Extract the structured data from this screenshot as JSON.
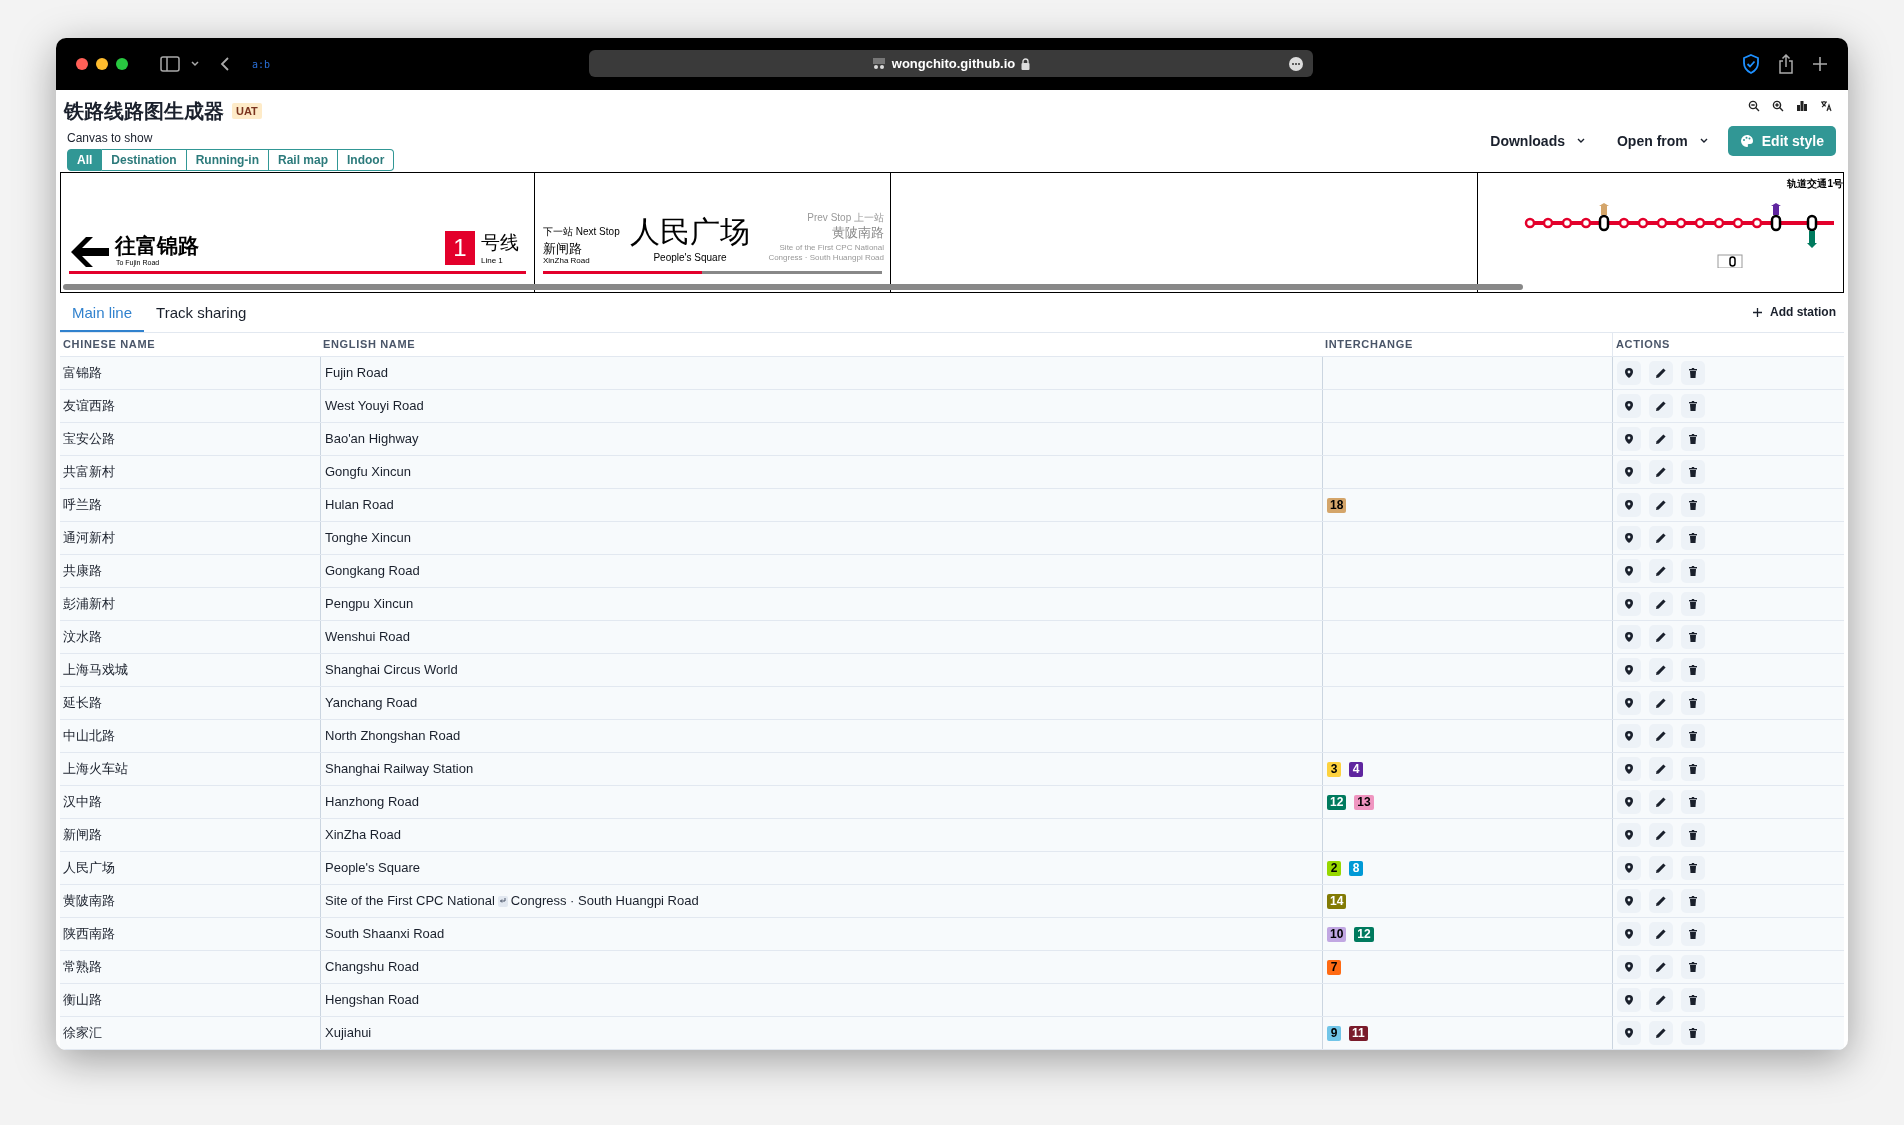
{
  "browser": {
    "extension_label": "a:b",
    "url": "wongchito.github.io"
  },
  "app": {
    "title": "铁路线路图生成器",
    "badge": "UAT",
    "canvas_label": "Canvas to show",
    "canvas_options": [
      {
        "label": "All",
        "selected": true
      },
      {
        "label": "Destination",
        "selected": false
      },
      {
        "label": "Running-in",
        "selected": false
      },
      {
        "label": "Rail map",
        "selected": false
      },
      {
        "label": "Indoor",
        "selected": false
      }
    ],
    "menus": [
      "Downloads",
      "Open from"
    ],
    "edit_button": "Edit style"
  },
  "canvas_preview": {
    "destination": {
      "direction": "往富锦路",
      "direction_en": "To Fujin Road",
      "line_number": "1",
      "line_label": "号线",
      "line_label_en": "Line 1"
    },
    "running_in": {
      "next_label": "下一站",
      "next_label_en": "Next Stop",
      "next_station": "新闸路",
      "next_station_en": "XinZha Road",
      "current": "人民广场",
      "current_en": "People's Square",
      "prev_label_en": "Prev Stop",
      "prev_label": "上一站",
      "prev_station": "黄陂南路",
      "prev_station_en": [
        "Site of the First CPC National",
        "Congress · South Huangpi Road"
      ],
      "level": 0.47
    },
    "rail_map": {
      "title": "轨道交通1号"
    }
  },
  "tabs": [
    {
      "label": "Main line",
      "selected": true
    },
    {
      "label": "Track sharing",
      "selected": false
    }
  ],
  "add_station": "Add station",
  "table": {
    "columns": [
      "CHINESE NAME",
      "ENGLISH NAME",
      "INTERCHANGE",
      "ACTIONS"
    ],
    "rows": [
      {
        "chinese": "富锦路",
        "english": [
          "Fujin Road"
        ],
        "interchange": []
      },
      {
        "chinese": "友谊西路",
        "english": [
          "West Youyi Road"
        ],
        "interchange": []
      },
      {
        "chinese": "宝安公路",
        "english": [
          "Bao'an Highway"
        ],
        "interchange": []
      },
      {
        "chinese": "共富新村",
        "english": [
          "Gongfu Xincun"
        ],
        "interchange": []
      },
      {
        "chinese": "呼兰路",
        "english": [
          "Hulan Road"
        ],
        "interchange": [
          {
            "label": "18",
            "color": "#d4a56a"
          }
        ]
      },
      {
        "chinese": "通河新村",
        "english": [
          "Tonghe Xincun"
        ],
        "interchange": []
      },
      {
        "chinese": "共康路",
        "english": [
          "Gongkang Road"
        ],
        "interchange": []
      },
      {
        "chinese": "彭浦新村",
        "english": [
          "Pengpu Xincun"
        ],
        "interchange": []
      },
      {
        "chinese": "汶水路",
        "english": [
          "Wenshui Road"
        ],
        "interchange": []
      },
      {
        "chinese": "上海马戏城",
        "english": [
          "Shanghai Circus World"
        ],
        "interchange": []
      },
      {
        "chinese": "延长路",
        "english": [
          "Yanchang Road"
        ],
        "interchange": []
      },
      {
        "chinese": "中山北路",
        "english": [
          "North Zhongshan Road"
        ],
        "interchange": []
      },
      {
        "chinese": "上海火车站",
        "english": [
          "Shanghai Railway Station"
        ],
        "interchange": [
          {
            "label": "3",
            "color": "#fdd23e"
          },
          {
            "label": "4",
            "color": "#5f259f"
          }
        ]
      },
      {
        "chinese": "汉中路",
        "english": [
          "Hanzhong Road"
        ],
        "interchange": [
          {
            "label": "12",
            "color": "#007a5e"
          },
          {
            "label": "13",
            "color": "#ef95c0"
          }
        ]
      },
      {
        "chinese": "新闸路",
        "english": [
          "XinZha Road"
        ],
        "interchange": []
      },
      {
        "chinese": "人民广场",
        "english": [
          "People's Square"
        ],
        "interchange": [
          {
            "label": "2",
            "color": "#97d700"
          },
          {
            "label": "8",
            "color": "#0099d6"
          }
        ]
      },
      {
        "chinese": "黄陂南路",
        "english": [
          "Site of the First CPC National",
          "Congress · South Huangpi Road"
        ],
        "interchange": [
          {
            "label": "14",
            "color": "#827a04"
          }
        ]
      },
      {
        "chinese": "陕西南路",
        "english": [
          "South Shaanxi Road"
        ],
        "interchange": [
          {
            "label": "10",
            "color": "#c1a7e2"
          },
          {
            "label": "12",
            "color": "#007a5e"
          }
        ]
      },
      {
        "chinese": "常熟路",
        "english": [
          "Changshu Road"
        ],
        "interchange": [
          {
            "label": "7",
            "color": "#ff6a13"
          }
        ]
      },
      {
        "chinese": "衡山路",
        "english": [
          "Hengshan Road"
        ],
        "interchange": []
      },
      {
        "chinese": "徐家汇",
        "english": [
          "Xujiahui"
        ],
        "interchange": [
          {
            "label": "9",
            "color": "#71c5e8"
          },
          {
            "label": "11",
            "color": "#7a1b2b"
          }
        ]
      }
    ]
  }
}
